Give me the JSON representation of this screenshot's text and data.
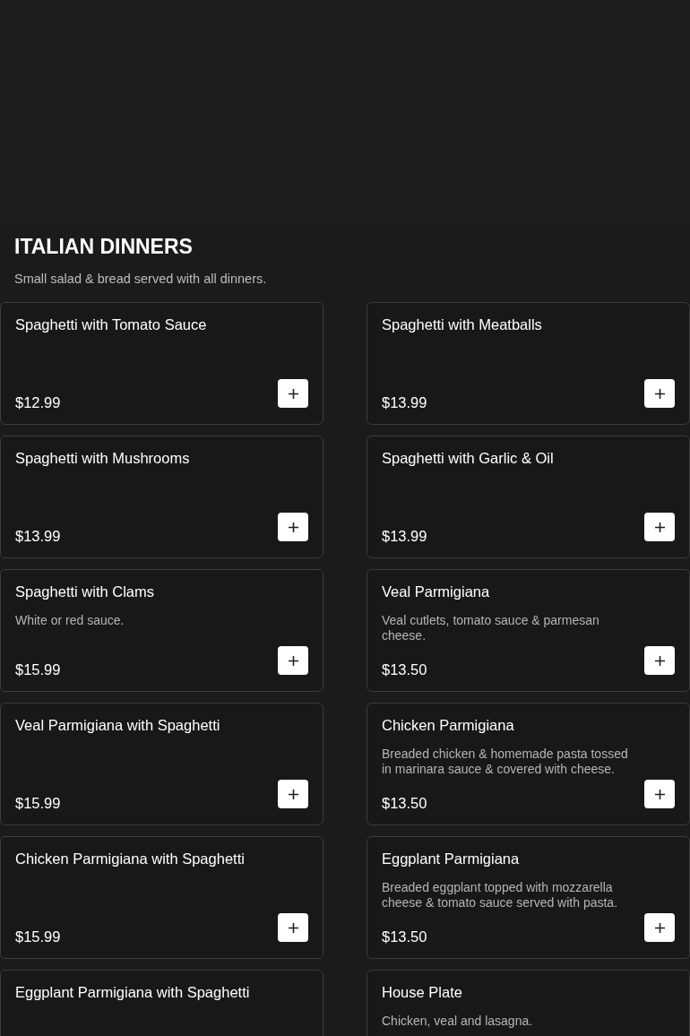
{
  "section": {
    "title": "ITALIAN DINNERS",
    "subtitle": "Small salad & bread served with all dinners."
  },
  "items": [
    {
      "name": "Spaghetti with Tomato Sauce",
      "price": "$12.99"
    },
    {
      "name": "Spaghetti with Meatballs",
      "price": "$13.99"
    },
    {
      "name": "Spaghetti with Mushrooms",
      "price": "$13.99"
    },
    {
      "name": "Spaghetti with Garlic & Oil",
      "price": "$13.99"
    },
    {
      "name": "Spaghetti with Clams",
      "description": "White or red sauce.",
      "price": "$15.99"
    },
    {
      "name": "Veal Parmigiana",
      "description": "Veal cutlets, tomato sauce & parmesan cheese.",
      "price": "$13.50"
    },
    {
      "name": "Veal Parmigiana with Spaghetti",
      "price": "$15.99"
    },
    {
      "name": "Chicken Parmigiana",
      "description": "Breaded chicken & homemade pasta tossed in marinara sauce & covered with cheese.",
      "price": "$13.50"
    },
    {
      "name": "Chicken Parmigiana with Spaghetti",
      "price": "$15.99"
    },
    {
      "name": "Eggplant Parmigiana",
      "description": "Breaded eggplant topped with mozzarella cheese & tomato sauce served with pasta.",
      "price": "$13.50"
    },
    {
      "name": "Eggplant Parmigiana with Spaghetti"
    },
    {
      "name": "House Plate",
      "description": "Chicken, veal and lasagna."
    }
  ]
}
